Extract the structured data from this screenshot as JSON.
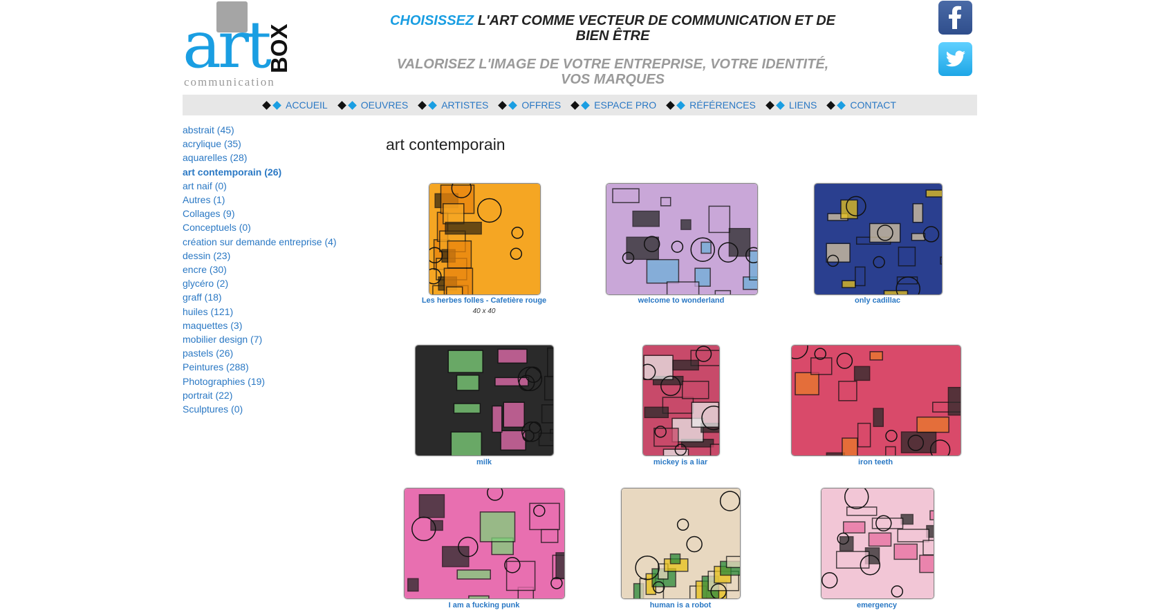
{
  "logo": {
    "art": "art",
    "box": "BOX",
    "tagline": "communication"
  },
  "header": {
    "highlight": "CHOISISSEZ",
    "line1_rest": " L'ART COMME VECTEUR DE COMMUNICATION ET DE BIEN ÊTRE",
    "line2": "VALORISEZ L'IMAGE DE VOTRE ENTREPRISE, VOTRE IDENTITÉ, VOS MARQUES"
  },
  "social": {
    "facebook": "facebook-icon",
    "twitter": "twitter-icon"
  },
  "nav": [
    "ACCUEIL",
    "OEUVRES",
    "ARTISTES",
    "OFFRES",
    "ESPACE PRO",
    "RÉFÉRENCES",
    "LIENS",
    "CONTACT"
  ],
  "categories": [
    "abstrait (45)",
    "acrylique (35)",
    "aquarelles (28)",
    "art contemporain (26)",
    "art naif (0)",
    "Autres (1)",
    "Collages (9)",
    "Conceptuels (0)",
    "création sur demande entreprise (4)",
    "dessin (23)",
    "encre (30)",
    "glycéro (2)",
    "graff (18)",
    "huiles (121)",
    "maquettes (3)",
    "mobilier design (7)",
    "pastels (26)",
    "Peintures (288)",
    "Photographies (19)",
    "portrait (22)",
    "Sculptures (0)"
  ],
  "active_category": "art contemporain (26)",
  "page_title": "art contemporain",
  "artworks": [
    {
      "title": "Les herbes folles - Cafetière rouge",
      "dims": "40 x 40",
      "palette": [
        "#f5a623",
        "#e8840e",
        "#3a2a10"
      ]
    },
    {
      "title": "welcome to wonderland",
      "palette": [
        "#c9a7d8",
        "#6fb0d9",
        "#2a2a2a"
      ]
    },
    {
      "title": "only cadillac",
      "palette": [
        "#2a3f8f",
        "#d9c6a0",
        "#e8c21a"
      ]
    },
    {
      "title": "milk",
      "palette": [
        "#2a2a2a",
        "#e86fb0",
        "#7ed27a"
      ]
    },
    {
      "title": "mickey is a liar",
      "palette": [
        "#c84a6a",
        "#2a2a2a",
        "#e8e8e8"
      ]
    },
    {
      "title": "iron teeth",
      "palette": [
        "#d94a6a",
        "#2a2a2a",
        "#e87a2a"
      ]
    },
    {
      "title": "I am a fucking punk",
      "palette": [
        "#e86fb0",
        "#2a2a2a",
        "#7ed27a"
      ]
    },
    {
      "title": "human is a robot",
      "palette": [
        "#e8d8c0",
        "#2a8a3a",
        "#e8c21a"
      ]
    },
    {
      "title": "emergency",
      "palette": [
        "#f2c6d6",
        "#e86fa0",
        "#2a2a2a"
      ]
    }
  ],
  "colors": {
    "link": "#2a78c4",
    "accent": "#1a9ee2",
    "nav_bg": "#e7e7e7"
  }
}
